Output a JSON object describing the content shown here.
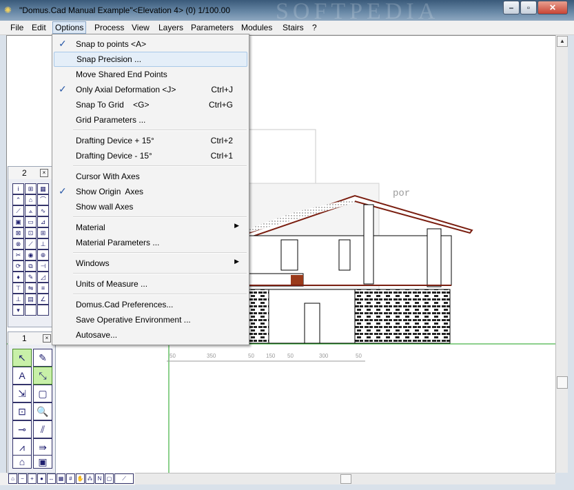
{
  "window": {
    "title": "\"Domus.Cad Manual Example\"<Elevation 4> (0) 1/100.00",
    "watermark": "SOFTPEDIA"
  },
  "menubar": [
    "File",
    "Edit",
    "Options",
    "Process",
    "View",
    "Layers",
    "Parameters",
    "Modules",
    "Stairs",
    "?"
  ],
  "options_menu": {
    "snap_points": {
      "label": "Snap to points <A>",
      "shortcut": ""
    },
    "snap_precision": {
      "label": "Snap Precision ...",
      "shortcut": ""
    },
    "move_shared": {
      "label": "Move Shared End Points",
      "shortcut": ""
    },
    "axial_deform": {
      "label": "Only Axial Deformation <J>",
      "shortcut": "Ctrl+J"
    },
    "snap_grid": {
      "label": "Snap To Grid    <G>",
      "shortcut": "Ctrl+G"
    },
    "grid_params": {
      "label": "Grid Parameters ...",
      "shortcut": ""
    },
    "drafting_plus": {
      "label": "Drafting Device + 15°",
      "shortcut": "Ctrl+2"
    },
    "drafting_minus": {
      "label": "Drafting Device - 15°",
      "shortcut": "Ctrl+1"
    },
    "cursor_axes": {
      "label": "Cursor With Axes",
      "shortcut": ""
    },
    "origin_axes": {
      "label": "Show Origin  Axes",
      "shortcut": ""
    },
    "wall_axes": {
      "label": "Show wall Axes",
      "shortcut": ""
    },
    "material": {
      "label": "Material",
      "shortcut": ""
    },
    "material_params": {
      "label": "Material Parameters ...",
      "shortcut": ""
    },
    "windows": {
      "label": "Windows",
      "shortcut": ""
    },
    "units": {
      "label": "Units of Measure ...",
      "shortcut": ""
    },
    "prefs": {
      "label": "Domus.Cad Preferences...",
      "shortcut": ""
    },
    "save_env": {
      "label": "Save Operative Environment ...",
      "shortcut": ""
    },
    "autosave": {
      "label": "Autosave...",
      "shortcut": ""
    }
  },
  "palette_top": {
    "number": "2"
  },
  "palette_bottom": {
    "number": "1"
  },
  "dimensions": [
    "50",
    "350",
    "50",
    "150",
    "50",
    "300",
    "50"
  ],
  "checked": [
    "snap_points",
    "axial_deform",
    "origin_axes"
  ],
  "background_text": "por"
}
